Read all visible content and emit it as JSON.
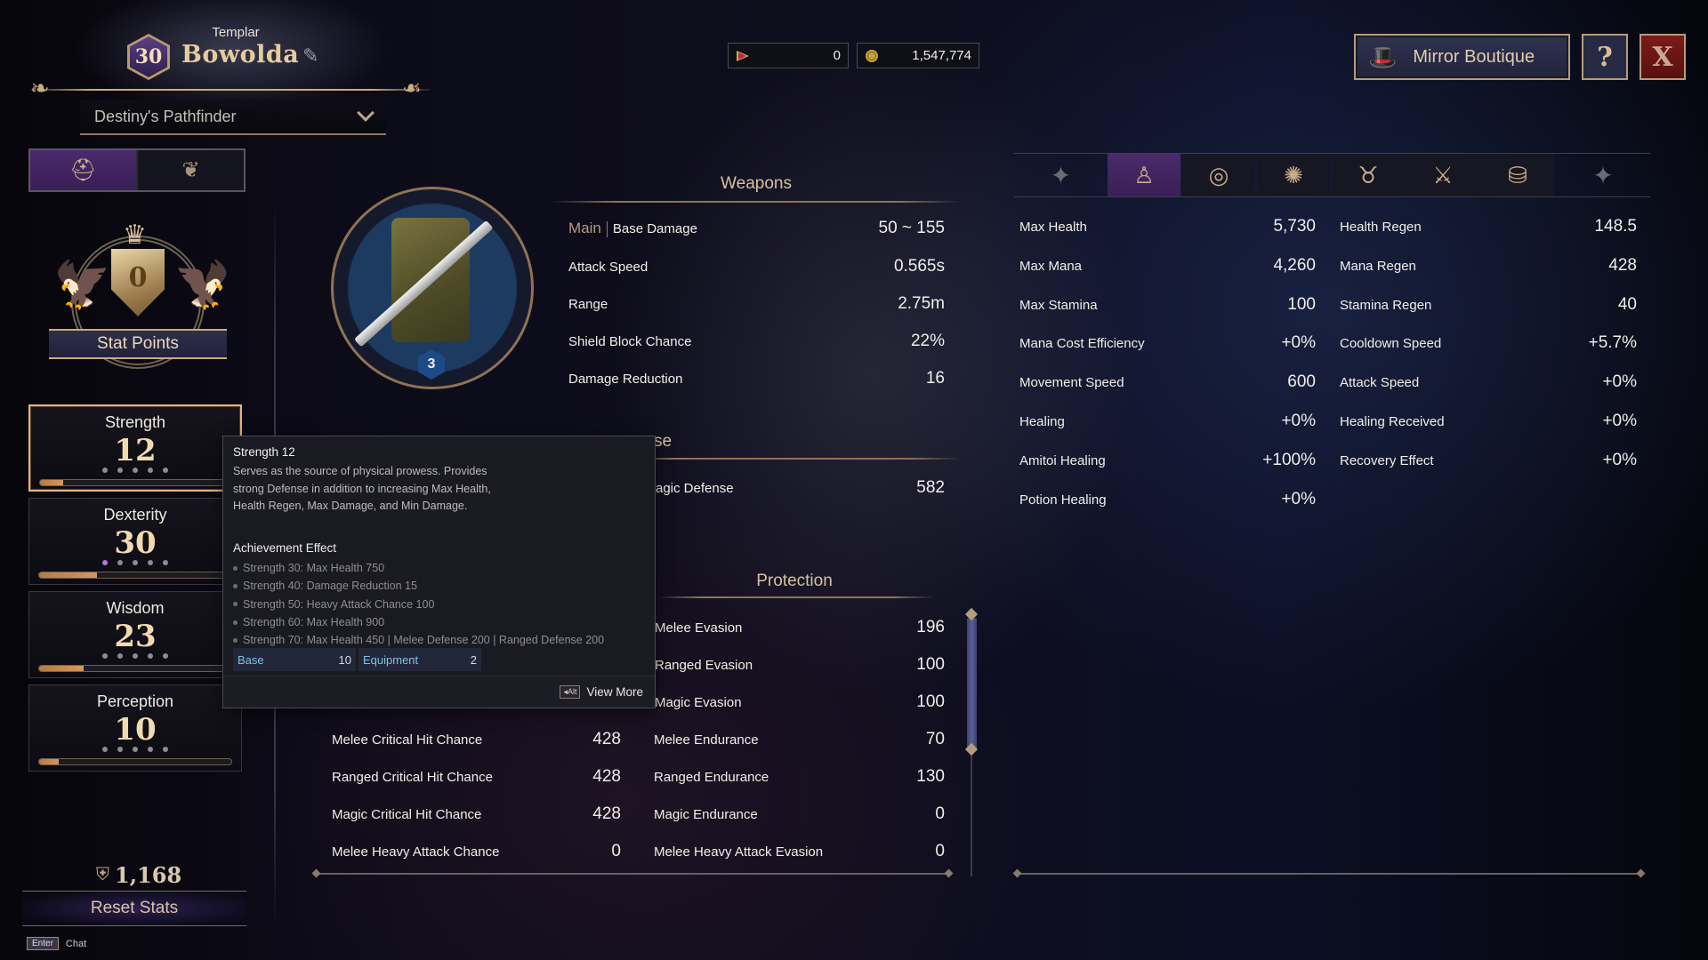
{
  "header": {
    "class_name": "Templar",
    "level": "30",
    "character_name": "Bowolda",
    "rename_icon": "quill-edit-icon",
    "title_select": {
      "value": "Destiny's Pathfinder"
    }
  },
  "mode_tabs": [
    {
      "name": "character-stats",
      "icon": "knight-helmet-icon",
      "glyph": "⛑",
      "active": true
    },
    {
      "name": "traits",
      "icon": "leaf-swirl-icon",
      "glyph": "❦",
      "active": false
    }
  ],
  "stat_points": {
    "label": "Stat Points",
    "value": "0"
  },
  "stats": [
    {
      "name": "Strength",
      "value": "12",
      "dots_lit": 0,
      "progress": 0.12,
      "selected": true
    },
    {
      "name": "Dexterity",
      "value": "30",
      "dots_lit": 1,
      "progress": 0.3,
      "selected": false
    },
    {
      "name": "Wisdom",
      "value": "23",
      "dots_lit": 0,
      "progress": 0.23,
      "selected": false
    },
    {
      "name": "Perception",
      "value": "10",
      "dots_lit": 0,
      "progress": 0.1,
      "selected": false
    }
  ],
  "reset": {
    "cost": "1,168",
    "label": "Reset Stats"
  },
  "chat_hint": {
    "key": "Enter",
    "label": "Chat"
  },
  "currency": [
    {
      "icon": "ruby-gem-icon",
      "value": "0",
      "color": "#b8283a"
    },
    {
      "icon": "gold-coin-icon",
      "value": "1,547,774",
      "color": "#c9a440"
    }
  ],
  "top_buttons": {
    "boutique_label": "Mirror Boutique",
    "help_glyph": "?",
    "close_glyph": "X"
  },
  "weapon": {
    "upgrade_level": "3"
  },
  "weapons_section": {
    "heading": "Weapons",
    "main_tag": "Main",
    "rows": [
      {
        "label": "Base Damage",
        "value": "50 ~ 155"
      },
      {
        "label": "Attack Speed",
        "value": "0.565s"
      },
      {
        "label": "Range",
        "value": "2.75m"
      },
      {
        "label": "Shield Block Chance",
        "value": "22%"
      },
      {
        "label": "Damage Reduction",
        "value": "16"
      }
    ]
  },
  "defense_section": {
    "heading_visible": "se",
    "rows": [
      {
        "label": "agic Defense",
        "value": "582"
      }
    ]
  },
  "offense_rows": [
    {
      "label": "Melee Critical Hit Chance",
      "value": "428"
    },
    {
      "label": "Ranged Critical Hit Chance",
      "value": "428"
    },
    {
      "label": "Magic Critical Hit Chance",
      "value": "428"
    },
    {
      "label": "Melee Heavy Attack Chance",
      "value": "0"
    }
  ],
  "protection_section": {
    "heading": "Protection",
    "rows": [
      {
        "label": "Melee Evasion",
        "value": "196"
      },
      {
        "label": "Ranged Evasion",
        "value": "100"
      },
      {
        "label": "Magic Evasion",
        "value": "100"
      },
      {
        "label": "Melee Endurance",
        "value": "70"
      },
      {
        "label": "Ranged Endurance",
        "value": "130"
      },
      {
        "label": "Magic Endurance",
        "value": "0"
      },
      {
        "label": "Melee Heavy Attack Evasion",
        "value": "0"
      }
    ]
  },
  "right_panel": {
    "tabs": [
      {
        "name": "body",
        "icon": "body-icon",
        "glyph": "♙",
        "active": true
      },
      {
        "name": "vortex",
        "icon": "vortex-icon",
        "glyph": "◎",
        "active": false
      },
      {
        "name": "beast",
        "icon": "wolf-head-icon",
        "glyph": "✺",
        "active": false
      },
      {
        "name": "demon",
        "icon": "demon-skull-icon",
        "glyph": "♉",
        "active": false
      },
      {
        "name": "combat",
        "icon": "crossed-swords-icon",
        "glyph": "⚔",
        "active": false
      },
      {
        "name": "coins",
        "icon": "coin-stack-icon",
        "glyph": "⛁",
        "active": false
      }
    ],
    "left_rows": [
      {
        "label": "Max Health",
        "value": "5,730"
      },
      {
        "label": "Max Mana",
        "value": "4,260"
      },
      {
        "label": "Max Stamina",
        "value": "100"
      },
      {
        "label": "Mana Cost Efficiency",
        "value": "+0%"
      },
      {
        "label": "Movement Speed",
        "value": "600"
      },
      {
        "label": "Healing",
        "value": "+0%"
      },
      {
        "label": "Amitoi Healing",
        "value": "+100%"
      },
      {
        "label": "Potion Healing",
        "value": "+0%"
      }
    ],
    "right_rows": [
      {
        "label": "Health Regen",
        "value": "148.5"
      },
      {
        "label": "Mana Regen",
        "value": "428"
      },
      {
        "label": "Stamina Regen",
        "value": "40"
      },
      {
        "label": "Cooldown Speed",
        "value": "+5.7%"
      },
      {
        "label": "Attack Speed",
        "value": "+0%"
      },
      {
        "label": "Healing Received",
        "value": "+0%"
      },
      {
        "label": "Recovery Effect",
        "value": "+0%"
      }
    ]
  },
  "tooltip": {
    "title": "Strength 12",
    "description": "Serves as the source of physical prowess. Provides strong Defense in addition to increasing Max Health, Health Regen, Max Damage, and Min Damage.",
    "achievement_title": "Achievement Effect",
    "achievements": [
      "Strength 30: Max Health 750",
      "Strength 40: Damage Reduction 15",
      "Strength 50: Heavy Attack Chance 100",
      "Strength 60: Max Health 900",
      "Strength 70: Max Health 450 | Melee Defense 200 | Ranged Defense 200"
    ],
    "breakdown": [
      {
        "label": "Base",
        "value": "10"
      },
      {
        "label": "Equipment",
        "value": "2"
      }
    ],
    "footer_key": "◂Alt",
    "footer_label": "View More"
  }
}
